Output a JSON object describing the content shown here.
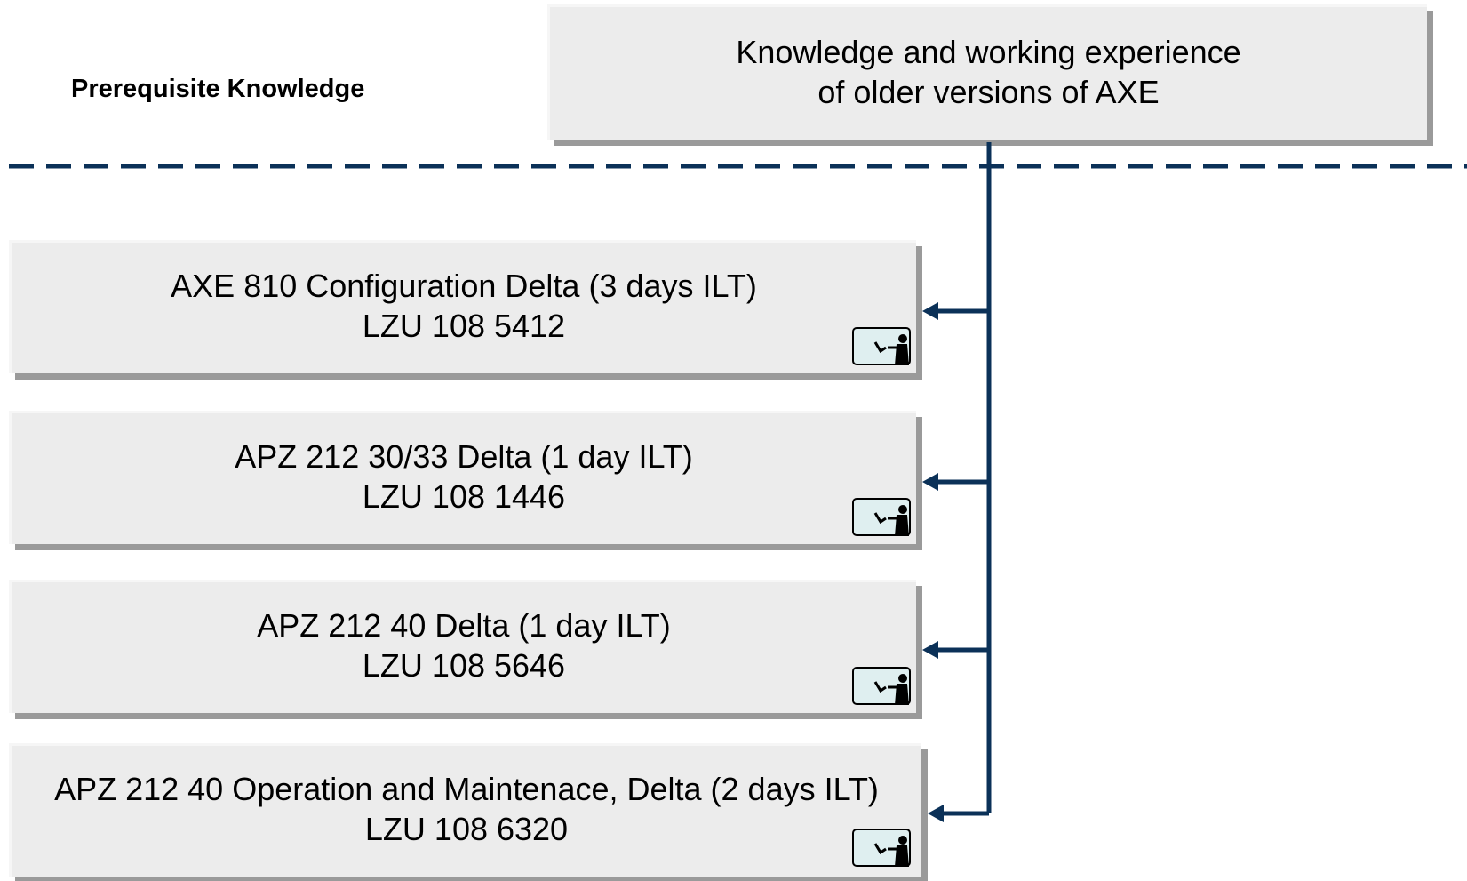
{
  "header": {
    "prerequisite_label": "Prerequisite Knowledge",
    "prerequisite_box": {
      "line1": "Knowledge and working experience",
      "line2": "of older versions of AXE"
    }
  },
  "courses": [
    {
      "title": "AXE 810 Configuration Delta (3 days ILT)",
      "code": "LZU 108 5412",
      "icon": "instructor-led-training-icon"
    },
    {
      "title": "APZ 212 30/33 Delta (1 day ILT)",
      "code": "LZU 108 1446",
      "icon": "instructor-led-training-icon"
    },
    {
      "title": "APZ 212 40 Delta (1 day ILT)",
      "code": "LZU 108 5646",
      "icon": "instructor-led-training-icon"
    },
    {
      "title": "APZ 212 40 Operation and Maintenace, Delta (2 days ILT)",
      "code": "LZU 108 6320",
      "icon": "instructor-led-training-icon"
    }
  ],
  "colors": {
    "connector": "#0b3158",
    "box_fill": "#ececec",
    "box_shadow": "#9a9a9a"
  }
}
